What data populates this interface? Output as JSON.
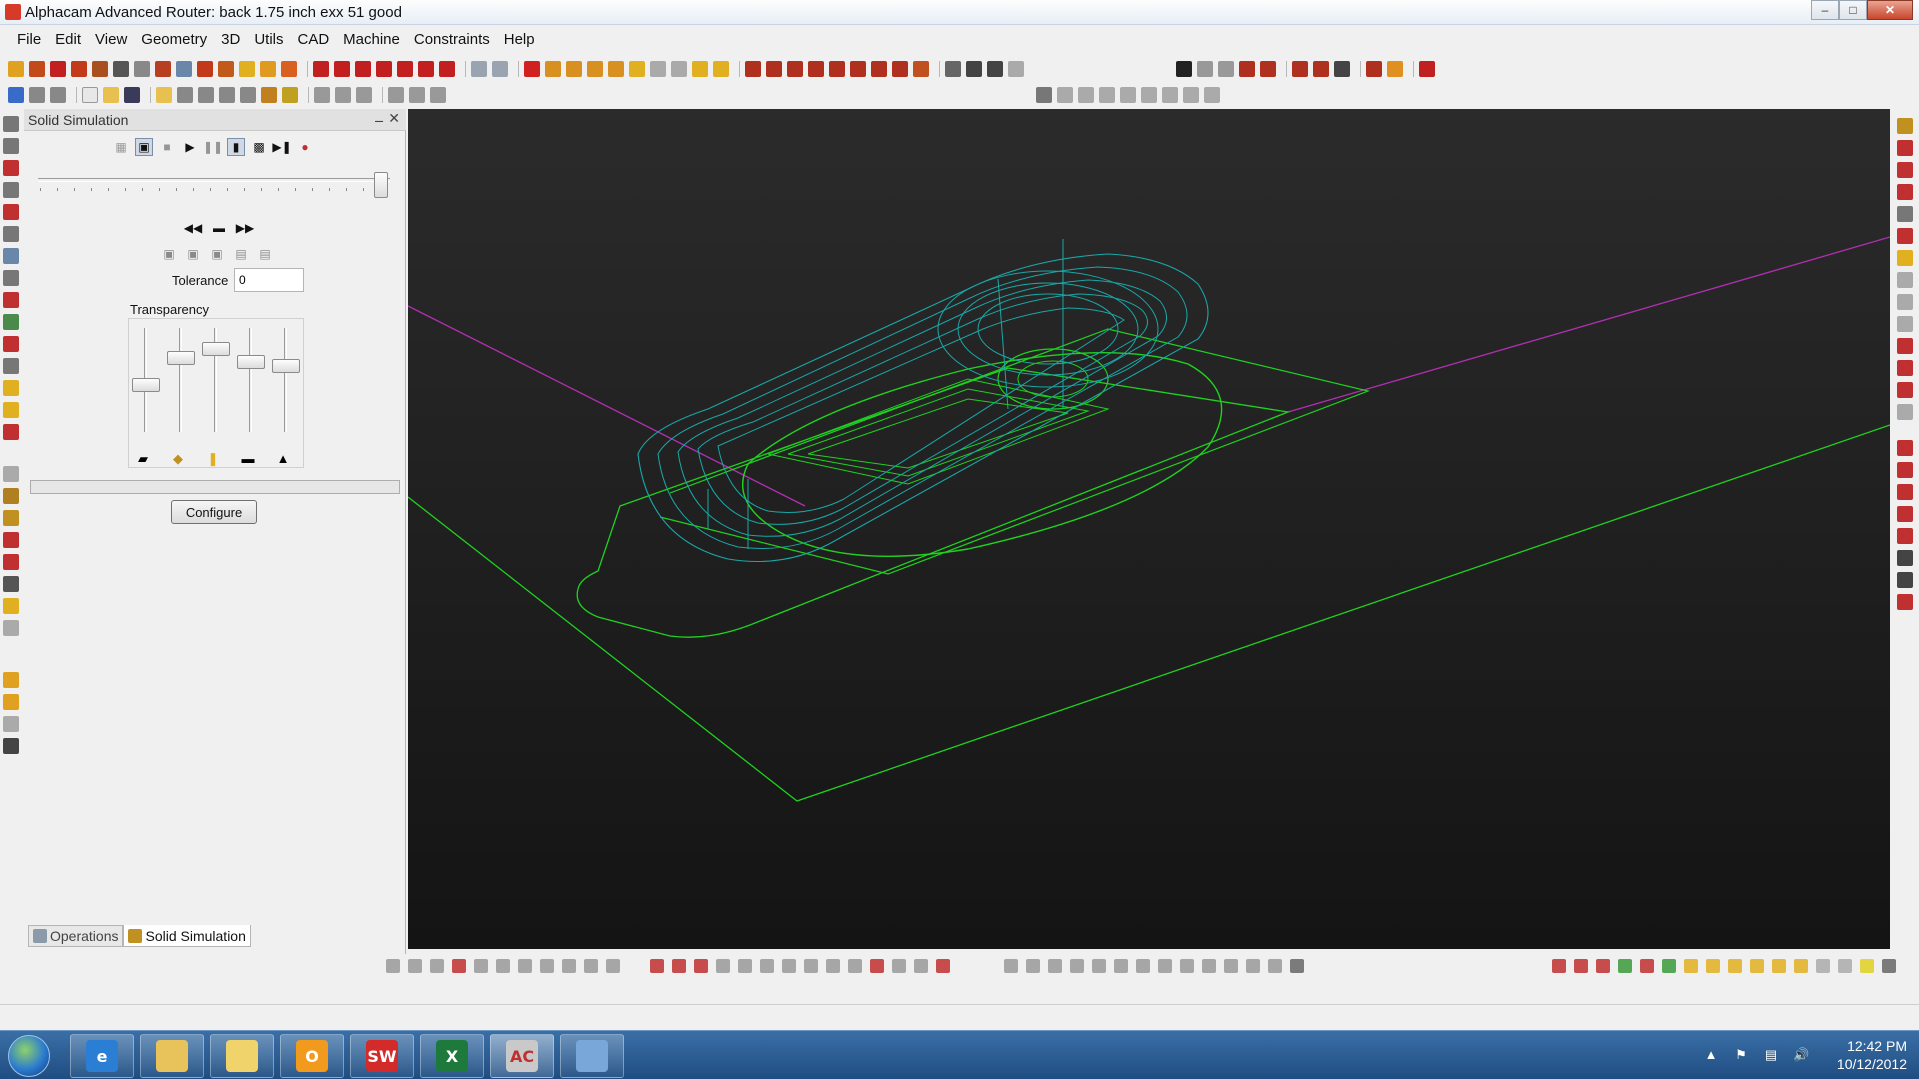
{
  "window": {
    "title": "Alphacam Advanced Router: back 1.75  inch exx 51 good",
    "minimize_label": "–",
    "maximize_label": "□",
    "close_label": "✕"
  },
  "menu": {
    "items": [
      "File",
      "Edit",
      "View",
      "Geometry",
      "3D",
      "Utils",
      "CAD",
      "Machine",
      "Constraints",
      "Help"
    ]
  },
  "panel": {
    "title": "Solid Simulation",
    "pin_icon": "pin-icon",
    "close_label": "✕",
    "tolerance_label": "Tolerance",
    "tolerance_value": "0",
    "transparency_label": "Transparency",
    "transparency_levels": [
      0.45,
      0.75,
      0.85,
      0.7,
      0.65
    ],
    "configure_label": "Configure",
    "tabs": [
      {
        "label": "Operations",
        "icon": "operations-icon",
        "active": false
      },
      {
        "label": "Solid Simulation",
        "icon": "simulation-icon",
        "active": true
      }
    ]
  },
  "taskbar": {
    "apps": [
      {
        "name": "internet-explorer",
        "glyph": "e",
        "color": "#2a7fd4"
      },
      {
        "name": "file-explorer",
        "glyph": "",
        "color": "#e8c25a"
      },
      {
        "name": "folder",
        "glyph": "",
        "color": "#f0d36b"
      },
      {
        "name": "outlook",
        "glyph": "O",
        "color": "#f29a1e"
      },
      {
        "name": "solidworks",
        "glyph": "SW",
        "color": "#d32a2a"
      },
      {
        "name": "excel",
        "glyph": "X",
        "color": "#1e7a3c"
      },
      {
        "name": "alphacam",
        "glyph": "AC",
        "color": "#c9c9c9"
      },
      {
        "name": "paint",
        "glyph": "",
        "color": "#7aa7d9"
      }
    ],
    "time": "12:42 PM",
    "date": "10/12/2012"
  },
  "colors": {
    "viewport_bg_top": "#2b2b2b",
    "viewport_bg_bottom": "#141414",
    "wire_green": "#1fd21f",
    "toolpath_cyan": "#1aa7a7",
    "axis_magenta": "#b12fb1"
  }
}
